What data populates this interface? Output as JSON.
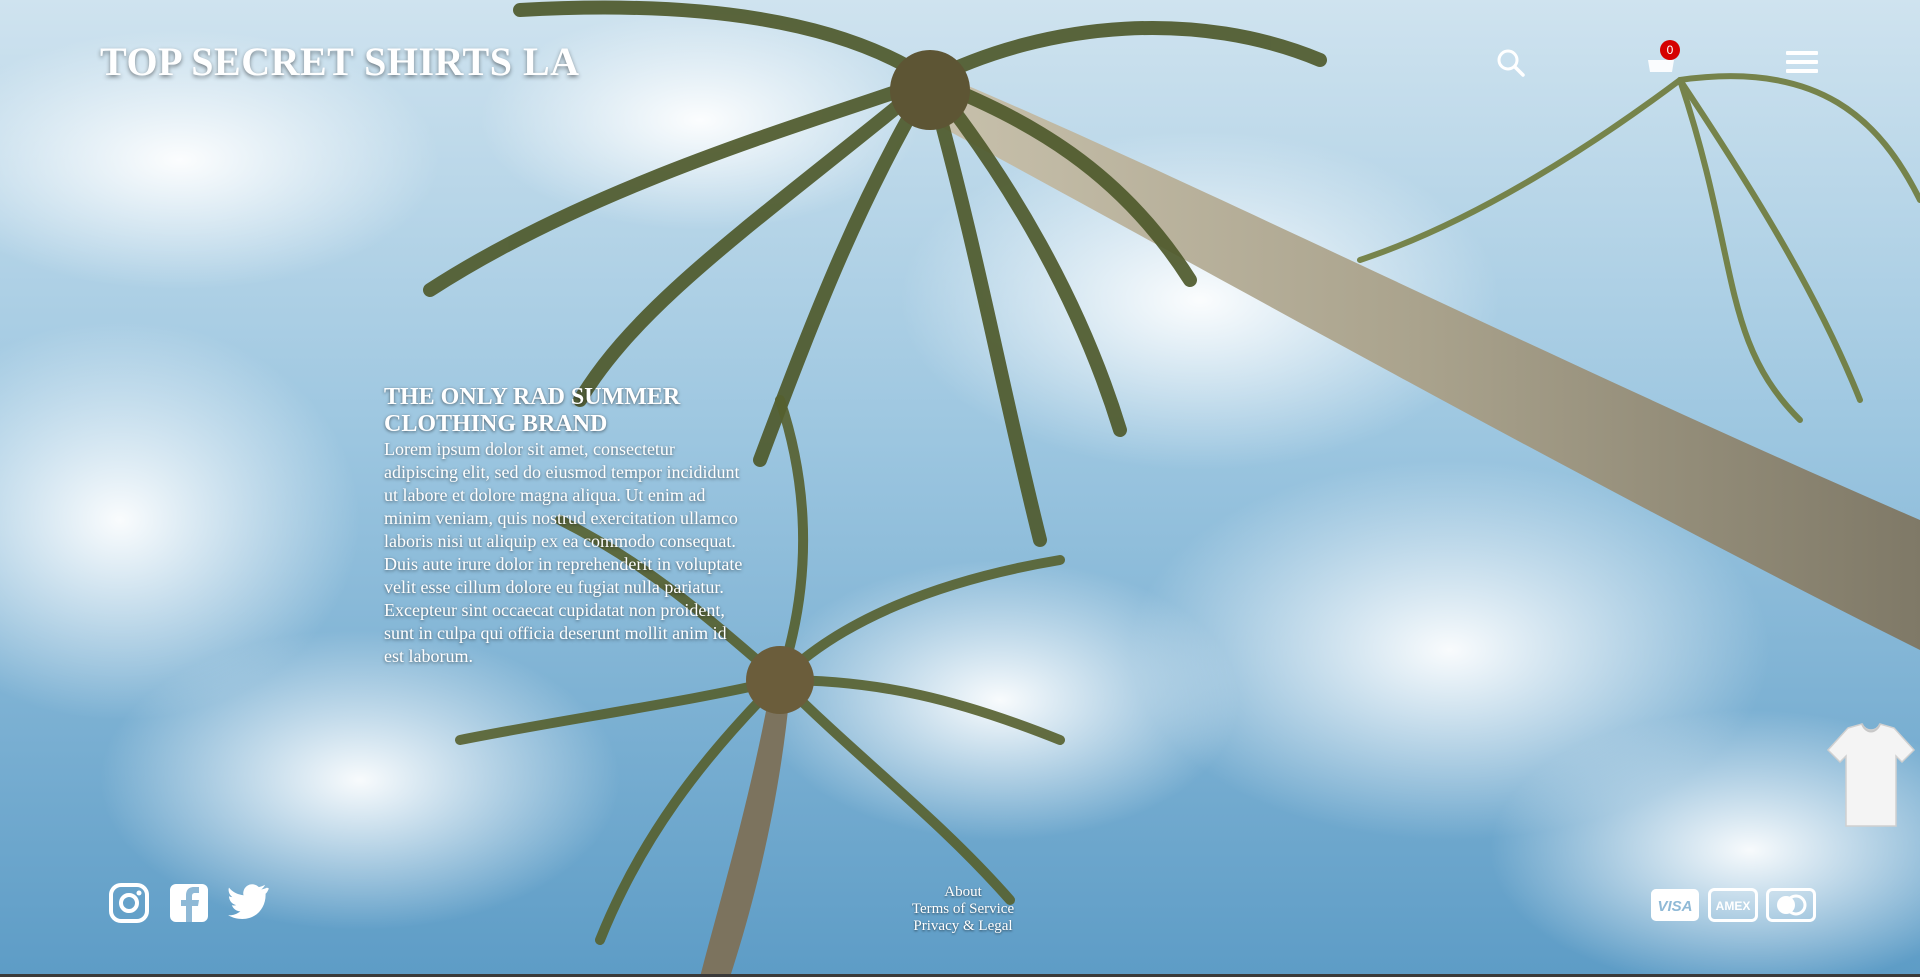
{
  "header": {
    "brand": "TOP SECRET SHIRTS LA",
    "search_icon": "search-icon",
    "cart_icon": "cart-icon",
    "cart_count": "0",
    "menu_icon": "hamburger-menu-icon"
  },
  "hero": {
    "title_line1": "THE ONLY RAD SUMMER",
    "title_line2": "CLOTHING BRAND",
    "body_lines": [
      "Lorem ipsum dolor sit amet, consectetur",
      "adipiscing elit, sed do eiusmod tempor incididunt",
      "ut labore et dolore magna aliqua. Ut enim ad",
      "minim veniam, quis nostrud exercitation ullamco",
      "laboris nisi ut aliquip ex ea commodo consequat.",
      "Duis aute irure dolor in reprehenderit in voluptate",
      "velit esse cillum dolore eu fugiat nulla pariatur.",
      "Excepteur sint occaecat cupidatat non proident,",
      "sunt in culpa qui officia deserunt mollit anim id",
      "est laborum."
    ]
  },
  "footer": {
    "social": [
      "instagram-icon",
      "facebook-icon",
      "twitter-icon"
    ],
    "links": {
      "about": "About",
      "terms": "Terms of Service",
      "privacy": "Privacy & Legal"
    },
    "payments": {
      "visa": "VISA",
      "amex": "AMEX",
      "mastercard_icon": "mastercard-icon"
    }
  },
  "colors": {
    "sky": "#8fb9d6",
    "badge": "#d50000",
    "text": "#ffffff"
  }
}
